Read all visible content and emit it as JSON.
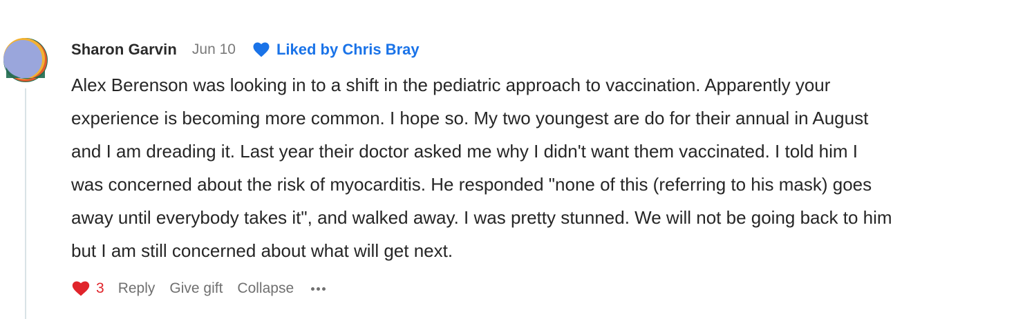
{
  "comment": {
    "author": "Sharon Garvin",
    "date": "Jun 10",
    "liked_by": "Liked by Chris Bray",
    "body": "Alex Berenson was looking in to a shift in the pediatric approach to vaccination. Apparently your\nexperience is becoming more common. I hope so. My two youngest are do for their annual in August\nand I am dreading it. Last year their doctor asked me why I didn't want them vaccinated. I told him I\nwas concerned about the risk of myocarditis. He responded \"none of this (referring to his mask) goes\naway until everybody takes it\", and walked away. I was pretty stunned. We will not be going back to him\nbut I am still concerned about what will get next.",
    "like_count": "3",
    "actions": {
      "reply": "Reply",
      "give_gift": "Give gift",
      "collapse": "Collapse"
    }
  },
  "icons": {
    "liked_by_icon": "heart-icon",
    "like_icon": "heart-icon",
    "more_icon": "ellipsis-icon"
  },
  "colors": {
    "liked_by_blue": "#1a73e8",
    "like_red": "#e0242b",
    "muted_text": "#707070"
  }
}
